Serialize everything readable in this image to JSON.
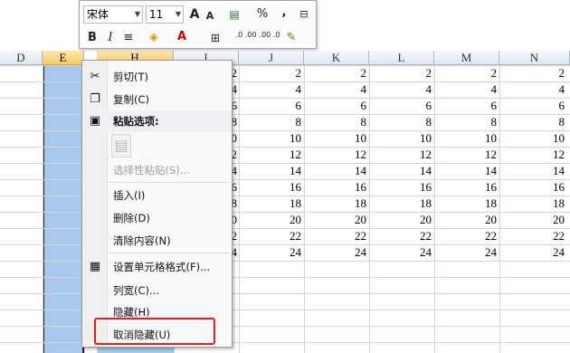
{
  "mini_toolbar": {
    "font": "宋体",
    "size": "11",
    "grow": "A",
    "shrink": "A",
    "percent": "%",
    "comma": ",",
    "bold": "B",
    "italic": "I",
    "font_color": "A",
    "dec_inc": ".0 .00",
    "dec_dec": ".00 .0"
  },
  "column_headers": [
    "D",
    "E",
    "H",
    "I",
    "J",
    "K",
    "L",
    "M",
    "N"
  ],
  "columns_right": [
    [
      "2",
      "4",
      "6",
      "8",
      "10",
      "12",
      "14",
      "16",
      "18",
      "20",
      "22",
      "24"
    ],
    [
      "2",
      "4",
      "6",
      "8",
      "10",
      "12",
      "14",
      "16",
      "18",
      "20",
      "22",
      "24"
    ],
    [
      "2",
      "4",
      "6",
      "8",
      "10",
      "12",
      "14",
      "16",
      "18",
      "20",
      "22",
      "24"
    ],
    [
      "2",
      "4",
      "6",
      "8",
      "10",
      "12",
      "14",
      "16",
      "18",
      "20",
      "22",
      "24"
    ],
    [
      "2",
      "4",
      "6",
      "8",
      "10",
      "12",
      "14",
      "16",
      "18",
      "20",
      "22",
      "24"
    ]
  ],
  "col_i_partial": [
    "2",
    "4",
    "6",
    "8",
    "0",
    "2",
    "4",
    "6",
    "8",
    "0",
    "2",
    "4"
  ],
  "menu": {
    "cut": "剪切(T)",
    "copy": "复制(C)",
    "paste_options": "粘贴选项:",
    "paste_special": "选择性粘贴(S)...",
    "insert": "插入(I)",
    "delete": "删除(D)",
    "clear": "清除内容(N)",
    "format_cells": "设置单元格格式(F)...",
    "col_width": "列宽(C)...",
    "hide": "隐藏(H)",
    "unhide": "取消隐藏(U)"
  }
}
